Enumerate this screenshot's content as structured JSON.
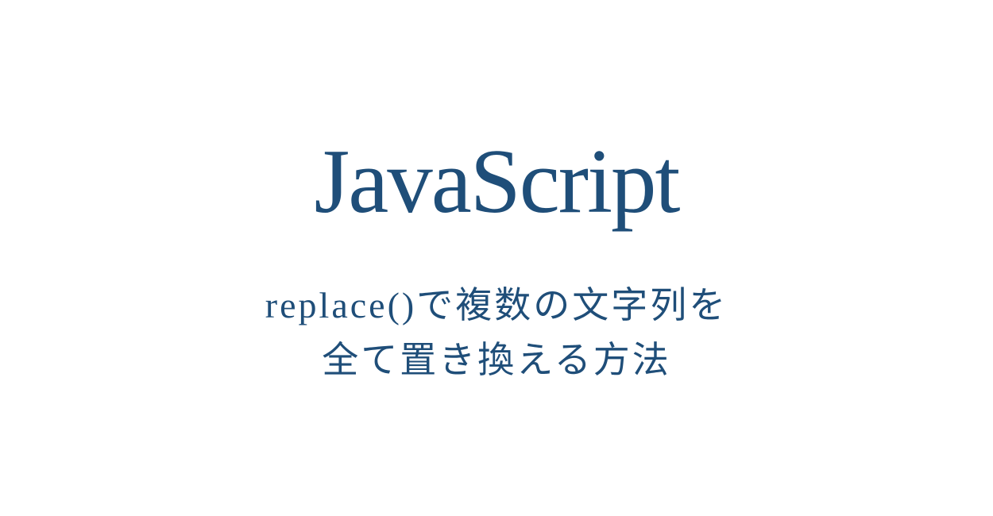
{
  "title": "JavaScript",
  "subtitle": {
    "line1": "replace()で複数の文字列を",
    "line2": "全て置き換える方法"
  },
  "colors": {
    "text": "#1f4e79",
    "background": "#ffffff"
  }
}
